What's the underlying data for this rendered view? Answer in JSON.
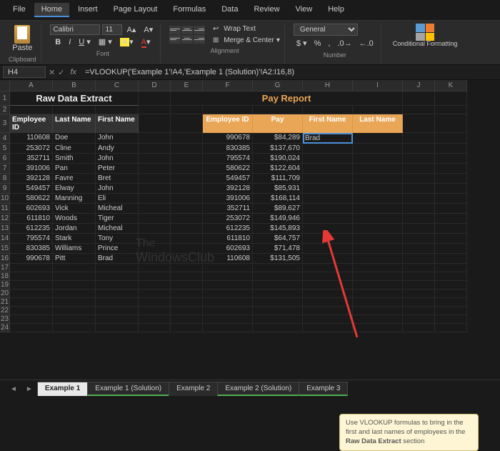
{
  "menu": [
    "File",
    "Home",
    "Insert",
    "Page Layout",
    "Formulas",
    "Data",
    "Review",
    "View",
    "Help"
  ],
  "active_menu": "Home",
  "ribbon": {
    "paste": "Paste",
    "clipboard": "Clipboard",
    "font_name": "Calibri",
    "font_size": "11",
    "font_label": "Font",
    "align_label": "Alignment",
    "wrap": "Wrap Text",
    "merge": "Merge & Center",
    "number_fmt": "General",
    "number_label": "Number",
    "cond_fmt": "Conditional Formatting"
  },
  "cell_ref": "H4",
  "formula": "=VLOOKUP('Example 1'!A4,'Example 1 (Solution)'!A2:I16,8)",
  "cols": [
    "A",
    "B",
    "C",
    "D",
    "E",
    "F",
    "G",
    "H",
    "I",
    "J",
    "K"
  ],
  "title_raw": "Raw Data Extract",
  "title_pay": "Pay Report",
  "hdr_raw": [
    "Employee ID",
    "Last Name",
    "First Name"
  ],
  "hdr_pay": [
    "Employee ID",
    "Pay",
    "First Name",
    "Last Name"
  ],
  "raw_rows": [
    [
      "110608",
      "Doe",
      "John"
    ],
    [
      "253072",
      "Cline",
      "Andy"
    ],
    [
      "352711",
      "Smith",
      "John"
    ],
    [
      "391006",
      "Pan",
      "Peter"
    ],
    [
      "392128",
      "Favre",
      "Bret"
    ],
    [
      "549457",
      "Elway",
      "John"
    ],
    [
      "580622",
      "Manning",
      "Eli"
    ],
    [
      "602693",
      "Vick",
      "Micheal"
    ],
    [
      "611810",
      "Woods",
      "Tiger"
    ],
    [
      "612235",
      "Jordan",
      "Micheal"
    ],
    [
      "795574",
      "Stark",
      "Tony"
    ],
    [
      "830385",
      "Williams",
      "Prince"
    ],
    [
      "990678",
      "Pitt",
      "Brad"
    ]
  ],
  "pay_rows": [
    [
      "990678",
      "$84,289",
      "Brad",
      ""
    ],
    [
      "830385",
      "$137,670",
      "",
      ""
    ],
    [
      "795574",
      "$190,024",
      "",
      ""
    ],
    [
      "580622",
      "$122,604",
      "",
      ""
    ],
    [
      "549457",
      "$111,709",
      "",
      ""
    ],
    [
      "392128",
      "$85,931",
      "",
      ""
    ],
    [
      "391006",
      "$168,114",
      "",
      ""
    ],
    [
      "352711",
      "$89,627",
      "",
      ""
    ],
    [
      "253072",
      "$149,946",
      "",
      ""
    ],
    [
      "612235",
      "$145,893",
      "",
      ""
    ],
    [
      "611810",
      "$64,757",
      "",
      ""
    ],
    [
      "602693",
      "$71,478",
      "",
      ""
    ],
    [
      "110608",
      "$131,505",
      "",
      ""
    ]
  ],
  "watermark1": "The",
  "watermark2": "WindowsClub",
  "note": "Use VLOOKUP formulas to bring in the first and last names of employees in the Raw Data Extract section",
  "note_bold": "Raw Data Extract",
  "tabs": [
    "Example 1",
    "Example 1 (Solution)",
    "Example 2",
    "Example 2 (Solution)",
    "Example 3"
  ],
  "active_tab": "Example 1"
}
